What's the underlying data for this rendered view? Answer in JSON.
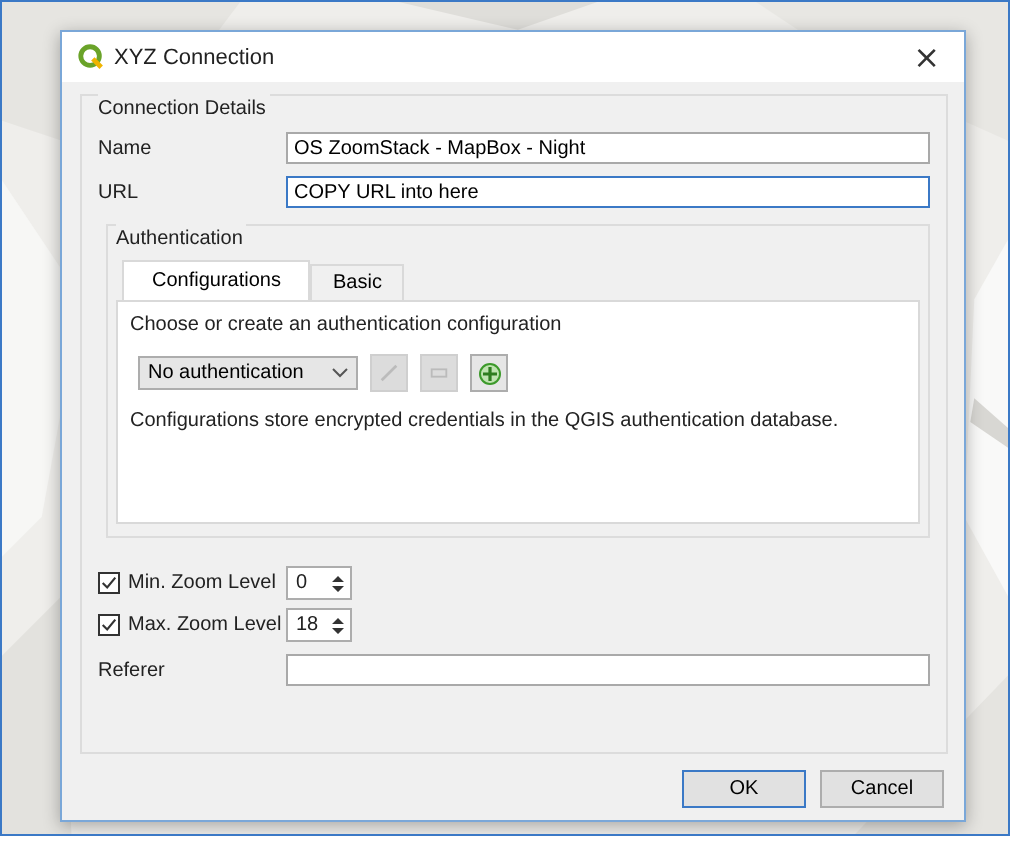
{
  "window": {
    "title": "XYZ Connection",
    "close": "×"
  },
  "connection_details": {
    "title": "Connection Details",
    "fields": [
      {
        "label": "Name",
        "value": "OS ZoomStack - MapBox - Night",
        "focused": false
      },
      {
        "label": "URL",
        "value": "COPY URL into here",
        "focused": true
      }
    ]
  },
  "authentication": {
    "title": "Authentication",
    "tabs": [
      {
        "label": "Configurations",
        "selected": true
      },
      {
        "label": "Basic",
        "selected": false
      }
    ],
    "prompt": "Choose or create an authentication configuration",
    "config_select": "No authentication",
    "buttons": [
      {
        "kind": "edit",
        "disabled": true
      },
      {
        "kind": "remove",
        "disabled": true
      },
      {
        "kind": "add",
        "disabled": false
      }
    ],
    "note": "Configurations store encrypted credentials in the QGIS authentication database."
  },
  "zoom_levels": [
    {
      "label": "Min. Zoom Level",
      "checked": true,
      "value": "0"
    },
    {
      "label": "Max. Zoom Level",
      "checked": true,
      "value": "18"
    }
  ],
  "referer": {
    "label": "Referer"
  },
  "buttons": [
    {
      "label": "OK",
      "default": true
    },
    {
      "label": "Cancel",
      "default": false
    }
  ]
}
